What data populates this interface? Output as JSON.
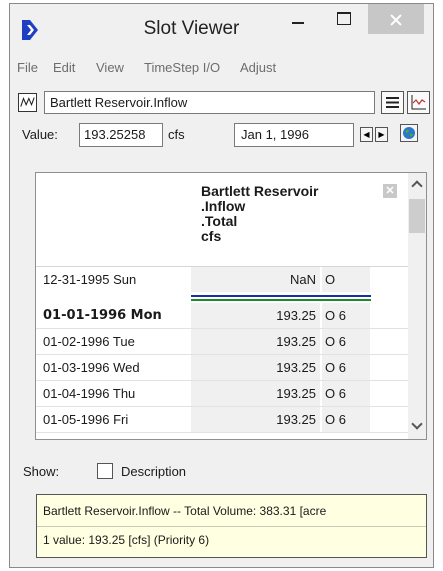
{
  "window": {
    "title": "Slot Viewer",
    "icon": "riverware-r-icon",
    "controls": [
      "minimize-icon",
      "maximize-icon",
      "close-icon"
    ]
  },
  "menu": [
    "File",
    "Edit",
    "View",
    "TimeStep I/O",
    "Adjust"
  ],
  "slot": {
    "name": "Bartlett Reservoir.Inflow",
    "icon": "slot-series-icon"
  },
  "value_row": {
    "label": "Value:",
    "value": "193.25258",
    "units": "cfs",
    "date": "Jan 1, 1996"
  },
  "table": {
    "column_header": [
      "Bartlett Reservoir",
      ".Inflow",
      ".Total",
      "cfs"
    ],
    "rows": [
      {
        "date": "12-31-1995 Sun",
        "value": "NaN",
        "flag": "O",
        "bold": false
      },
      {
        "date": "01-01-1996 Mon",
        "value": "193.25",
        "flag": "O 6",
        "bold": true
      },
      {
        "date": "01-02-1996 Tue",
        "value": "193.25",
        "flag": "O 6",
        "bold": false
      },
      {
        "date": "01-03-1996 Wed",
        "value": "193.25",
        "flag": "O 6",
        "bold": false
      },
      {
        "date": "01-04-1996 Thu",
        "value": "193.25",
        "flag": "O 6",
        "bold": false
      },
      {
        "date": "01-05-1996 Fri",
        "value": "193.25",
        "flag": "O 6",
        "bold": false
      }
    ]
  },
  "show": {
    "label": "Show:",
    "description_label": "Description",
    "description_checked": false
  },
  "info": {
    "line1": "Bartlett Reservoir.Inflow -- Total Volume: 383.31 [acre",
    "line2": "1 value:  193.25 [cfs]  (Priority 6)"
  },
  "colors": {
    "current_timestep_line": "#1a2fa0",
    "current_timestep_line_2": "#1c8a2a",
    "info_background": "#ffffe1",
    "app_icon": "#1e3fc4"
  }
}
